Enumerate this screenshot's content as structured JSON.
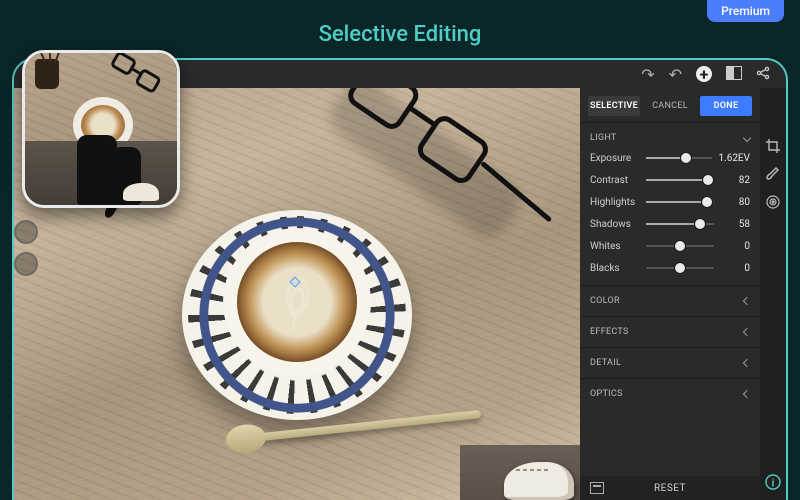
{
  "marketing": {
    "badge": "Premium",
    "headline": "Selective Editing"
  },
  "tabs": {
    "selective": "SELECTIVE",
    "cancel": "CANCEL",
    "done": "DONE"
  },
  "sections": {
    "light": "LIGHT",
    "color": "COLOR",
    "effects": "EFFECTS",
    "detail": "DETAIL",
    "optics": "OPTICS"
  },
  "light": {
    "exposure": {
      "label": "Exposure",
      "value": "1.62EV",
      "pct": 60
    },
    "contrast": {
      "label": "Contrast",
      "value": "82",
      "pct": 91
    },
    "highlights": {
      "label": "Highlights",
      "value": "80",
      "pct": 90
    },
    "shadows": {
      "label": "Shadows",
      "value": "58",
      "pct": 79
    },
    "whites": {
      "label": "Whites",
      "value": "0",
      "pct": 50
    },
    "blacks": {
      "label": "Blacks",
      "value": "0",
      "pct": 50
    }
  },
  "bottom": {
    "reset": "RESET"
  },
  "icons": {
    "redo": "↷",
    "undo": "↶",
    "add": "+",
    "compare": "◧",
    "share": "share",
    "crop": "crop",
    "brush": "brush",
    "radial": "radial",
    "info": "i"
  }
}
